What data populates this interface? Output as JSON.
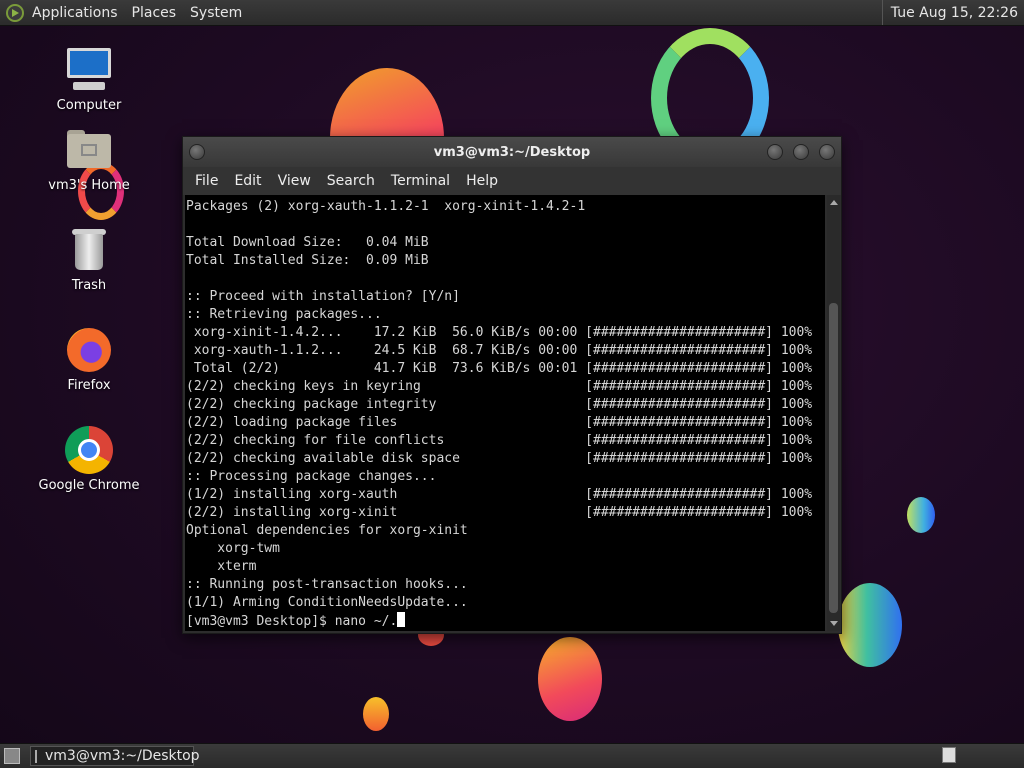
{
  "top_panel": {
    "menus": [
      "Applications",
      "Places",
      "System"
    ],
    "clock": "Tue Aug 15, 22:26"
  },
  "desktop_icons": [
    {
      "label": "Computer",
      "icon": "computer-icon"
    },
    {
      "label": "vm3's Home",
      "icon": "home-folder-icon"
    },
    {
      "label": "Trash",
      "icon": "trash-icon"
    },
    {
      "label": "Firefox",
      "icon": "firefox-icon"
    },
    {
      "label": "Google Chrome",
      "icon": "chrome-icon"
    }
  ],
  "terminal": {
    "title": "vm3@vm3:~/Desktop",
    "menus": [
      "File",
      "Edit",
      "View",
      "Search",
      "Terminal",
      "Help"
    ],
    "lines": [
      "Packages (2) xorg-xauth-1.1.2-1  xorg-xinit-1.4.2-1",
      "",
      "Total Download Size:   0.04 MiB",
      "Total Installed Size:  0.09 MiB",
      "",
      ":: Proceed with installation? [Y/n]",
      ":: Retrieving packages...",
      " xorg-xinit-1.4.2...    17.2 KiB  56.0 KiB/s 00:00 [######################] 100%",
      " xorg-xauth-1.1.2...    24.5 KiB  68.7 KiB/s 00:00 [######################] 100%",
      " Total (2/2)            41.7 KiB  73.6 KiB/s 00:01 [######################] 100%",
      "(2/2) checking keys in keyring                     [######################] 100%",
      "(2/2) checking package integrity                   [######################] 100%",
      "(2/2) loading package files                        [######################] 100%",
      "(2/2) checking for file conflicts                  [######################] 100%",
      "(2/2) checking available disk space                [######################] 100%",
      ":: Processing package changes...",
      "(1/2) installing xorg-xauth                        [######################] 100%",
      "(2/2) installing xorg-xinit                        [######################] 100%",
      "Optional dependencies for xorg-xinit",
      "    xorg-twm",
      "    xterm",
      ":: Running post-transaction hooks...",
      "(1/1) Arming ConditionNeedsUpdate..."
    ],
    "prompt": "[vm3@vm3 Desktop]$ nano ~/."
  },
  "taskbar": {
    "task_label": "vm3@vm3:~/Desktop"
  }
}
